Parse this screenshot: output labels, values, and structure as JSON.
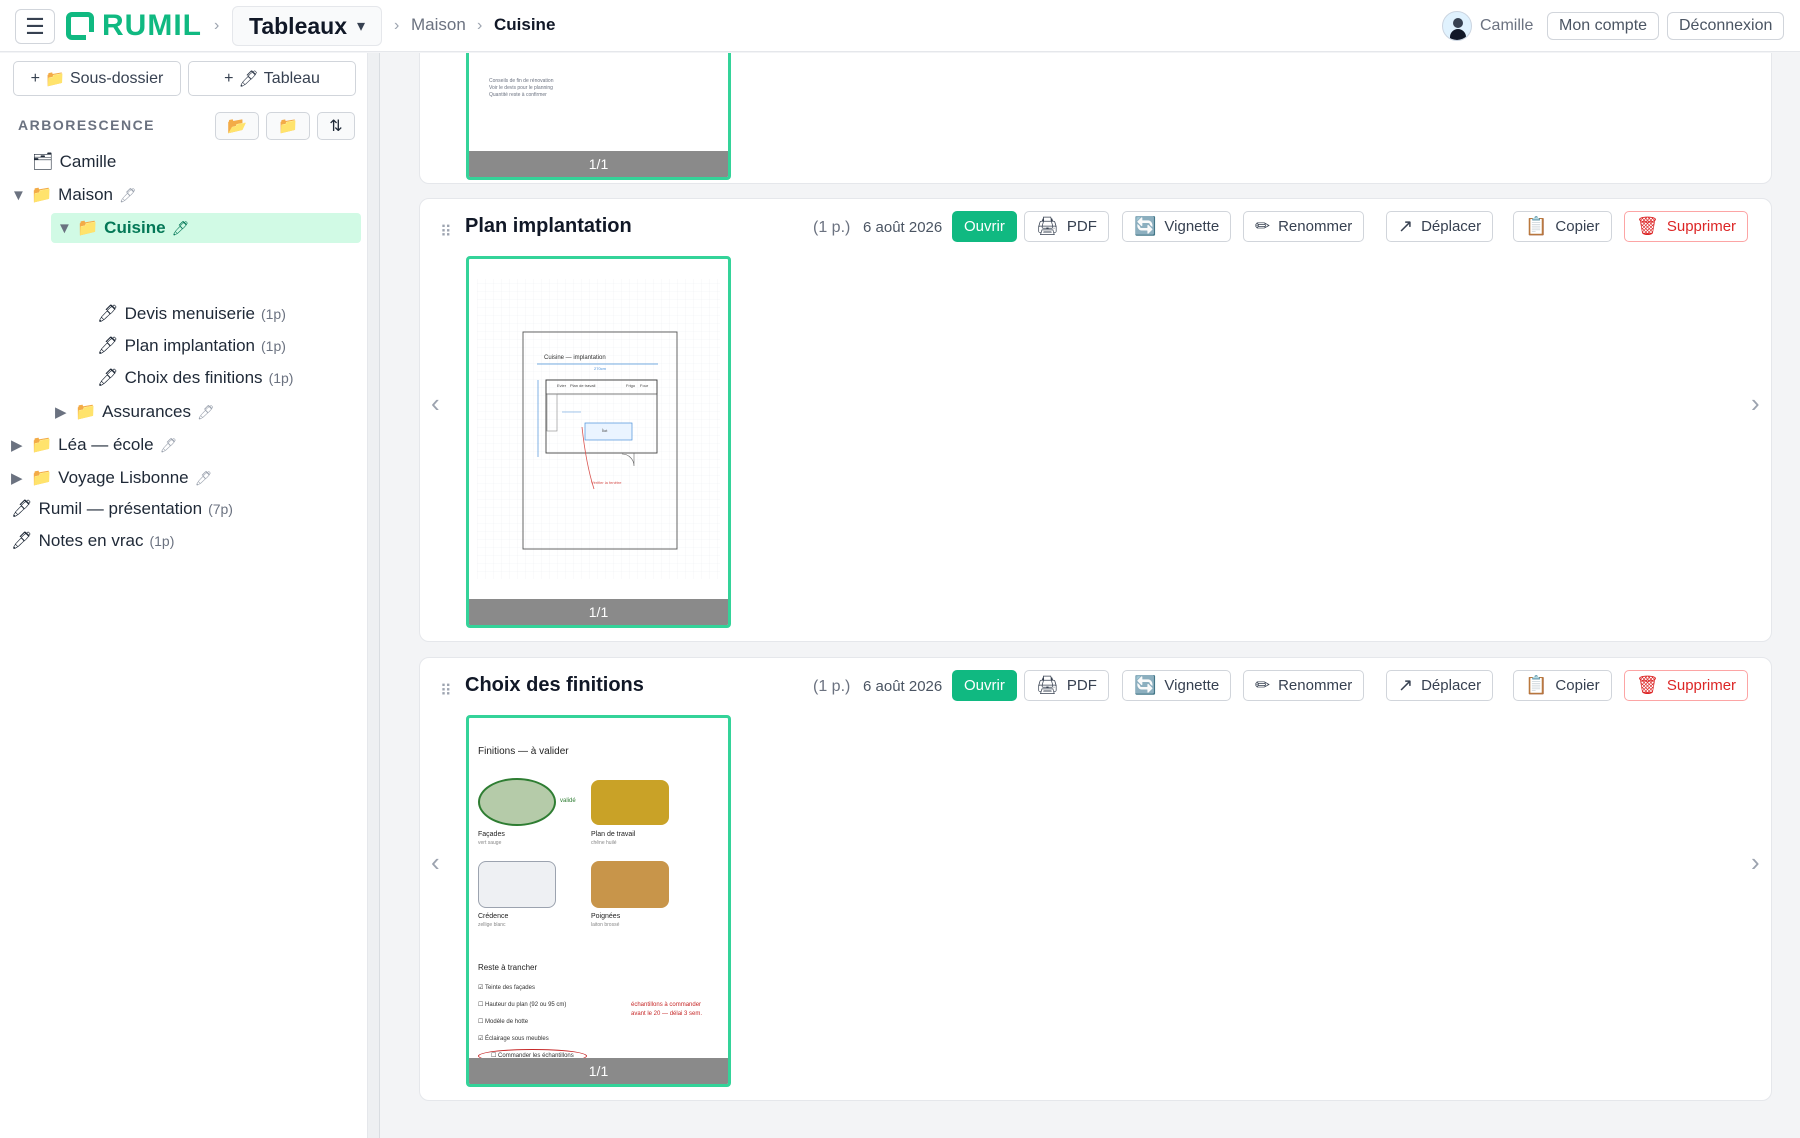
{
  "header": {
    "logo_text": "RUMIL",
    "board_select": "Tableaux",
    "select_caret": "▾",
    "breadcrumb": [
      "Maison",
      "Cuisine"
    ],
    "user_name": "Camille",
    "account_btn": "Mon compte",
    "logout_btn": "Déconnexion"
  },
  "sidebar": {
    "new_folder": "Sous-dossier",
    "new_board": "Tableau",
    "tree_heading": "ARBORESCENCE",
    "tree": [
      {
        "label": "Camille"
      },
      {
        "label": "Maison"
      },
      {
        "label": "Cuisine"
      },
      {
        "label": "Devis menuiserie",
        "count": "(1p)"
      },
      {
        "label": "Plan implantation",
        "count": "(1p)"
      },
      {
        "label": "Choix des finitions",
        "count": "(1p)"
      },
      {
        "label": "Assurances"
      },
      {
        "label": "Léa — école"
      },
      {
        "label": "Voyage Lisbonne"
      },
      {
        "label": "Rumil — présentation",
        "count": "(7p)"
      },
      {
        "label": "Notes en vrac",
        "count": "(1p)"
      }
    ]
  },
  "actions": {
    "open": "Ouvrir",
    "pdf": "PDF",
    "thumbnail": "Vignette",
    "rename": "Renommer",
    "move": "Déplacer",
    "copy": "Copier",
    "delete": "Supprimer"
  },
  "cards": [
    {
      "title": "",
      "pages": "",
      "date": "",
      "page_indicator": "1/1",
      "thumb_text": [
        "Conseils de fin de rénovation",
        "Voir le devis pour le planning",
        "Quantité reste à confirmer"
      ]
    },
    {
      "title": "Plan implantation",
      "pages": "(1 p.)",
      "date": "6 août 2026",
      "page_indicator": "1/1",
      "thumb_text": [
        "Cuisine — implantation",
        "Evier",
        "Plan de travail",
        "Îlot",
        "Frigo",
        "Four",
        "270cm",
        "Vérifier la fenêtre"
      ]
    },
    {
      "title": "Choix des finitions",
      "pages": "(1 p.)",
      "date": "6 août 2026",
      "page_indicator": "1/1",
      "thumb_text": [
        "Finitions — à valider",
        "validé",
        "Façades",
        "vert sauge",
        "Plan de travail",
        "chêne huilé",
        "Crédence",
        "zellige blanc",
        "Poignées",
        "laiton brossé",
        "Reste à trancher",
        "Teinte des façades",
        "Hauteur du plan (92 ou 95 cm)",
        "Modèle de hotte",
        "Éclairage sous meubles",
        "Commander les échantillons",
        "échantillons à commander avant le 20 — délai 3 sem."
      ]
    }
  ]
}
